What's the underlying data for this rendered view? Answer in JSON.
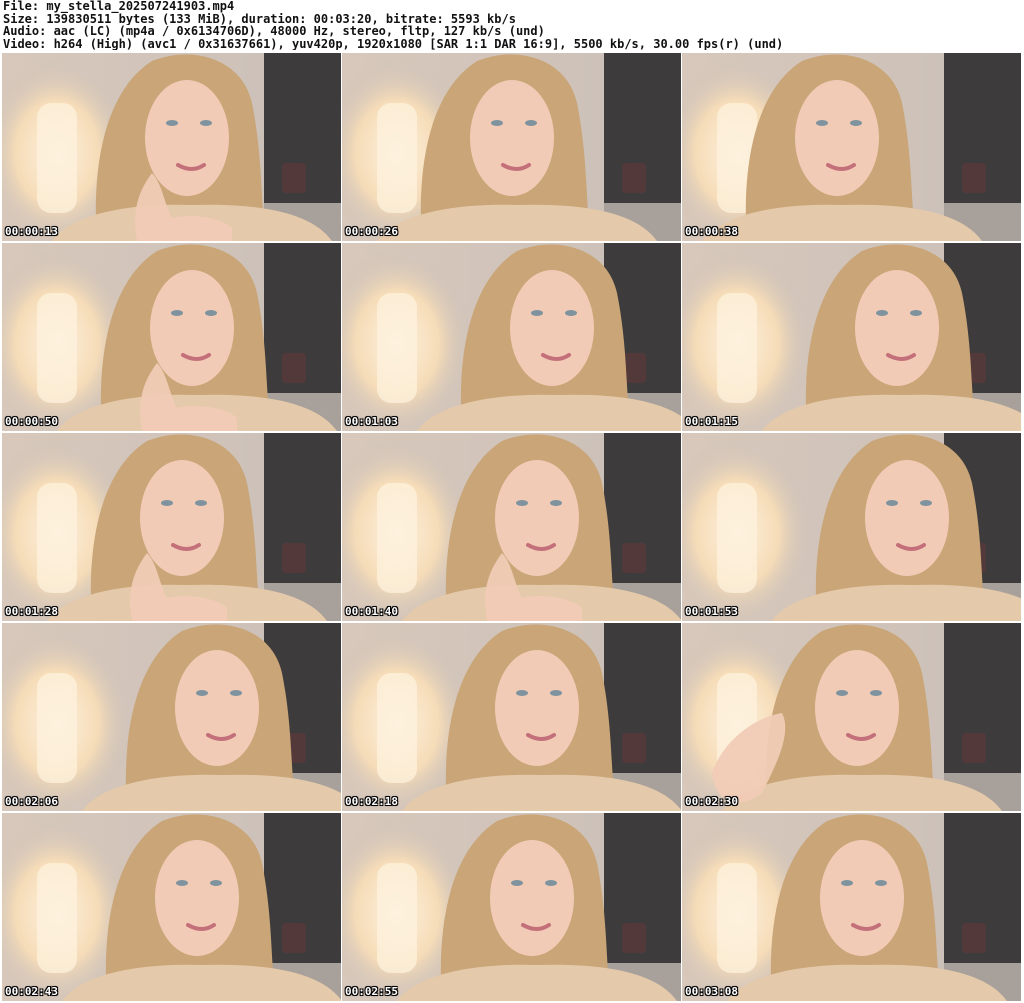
{
  "header": {
    "file_line": "File: my_stella_202507241903.mp4",
    "size_line": "Size: 139830511 bytes (133 MiB), duration: 00:03:20, bitrate: 5593 kb/s",
    "audio_line": "Audio: aac (LC) (mp4a / 0x6134706D), 48000 Hz, stereo, fltp, 127 kb/s (und)",
    "video_line": "Video: h264 (High) (avc1 / 0x31637661), yuv420p, 1920x1080 [SAR 1:1 DAR 16:9], 5500 kb/s, 30.00 fps(r) (und)"
  },
  "thumbnails": [
    {
      "timestamp": "00:00:13"
    },
    {
      "timestamp": "00:00:26"
    },
    {
      "timestamp": "00:00:38"
    },
    {
      "timestamp": "00:00:50"
    },
    {
      "timestamp": "00:01:03"
    },
    {
      "timestamp": "00:01:15"
    },
    {
      "timestamp": "00:01:28"
    },
    {
      "timestamp": "00:01:40"
    },
    {
      "timestamp": "00:01:53"
    },
    {
      "timestamp": "00:02:06"
    },
    {
      "timestamp": "00:02:18"
    },
    {
      "timestamp": "00:02:30"
    },
    {
      "timestamp": "00:02:43"
    },
    {
      "timestamp": "00:02:55"
    },
    {
      "timestamp": "00:03:08"
    }
  ],
  "colors": {
    "wall": "#c9bfb8",
    "lamp_glow": "#f6dcb8",
    "lamp_core": "#fdf1de",
    "dark_panel": "#3d3b3c",
    "hair": "#c9a577",
    "skin": "#f1cbb6",
    "top": "#e4c9aa"
  }
}
